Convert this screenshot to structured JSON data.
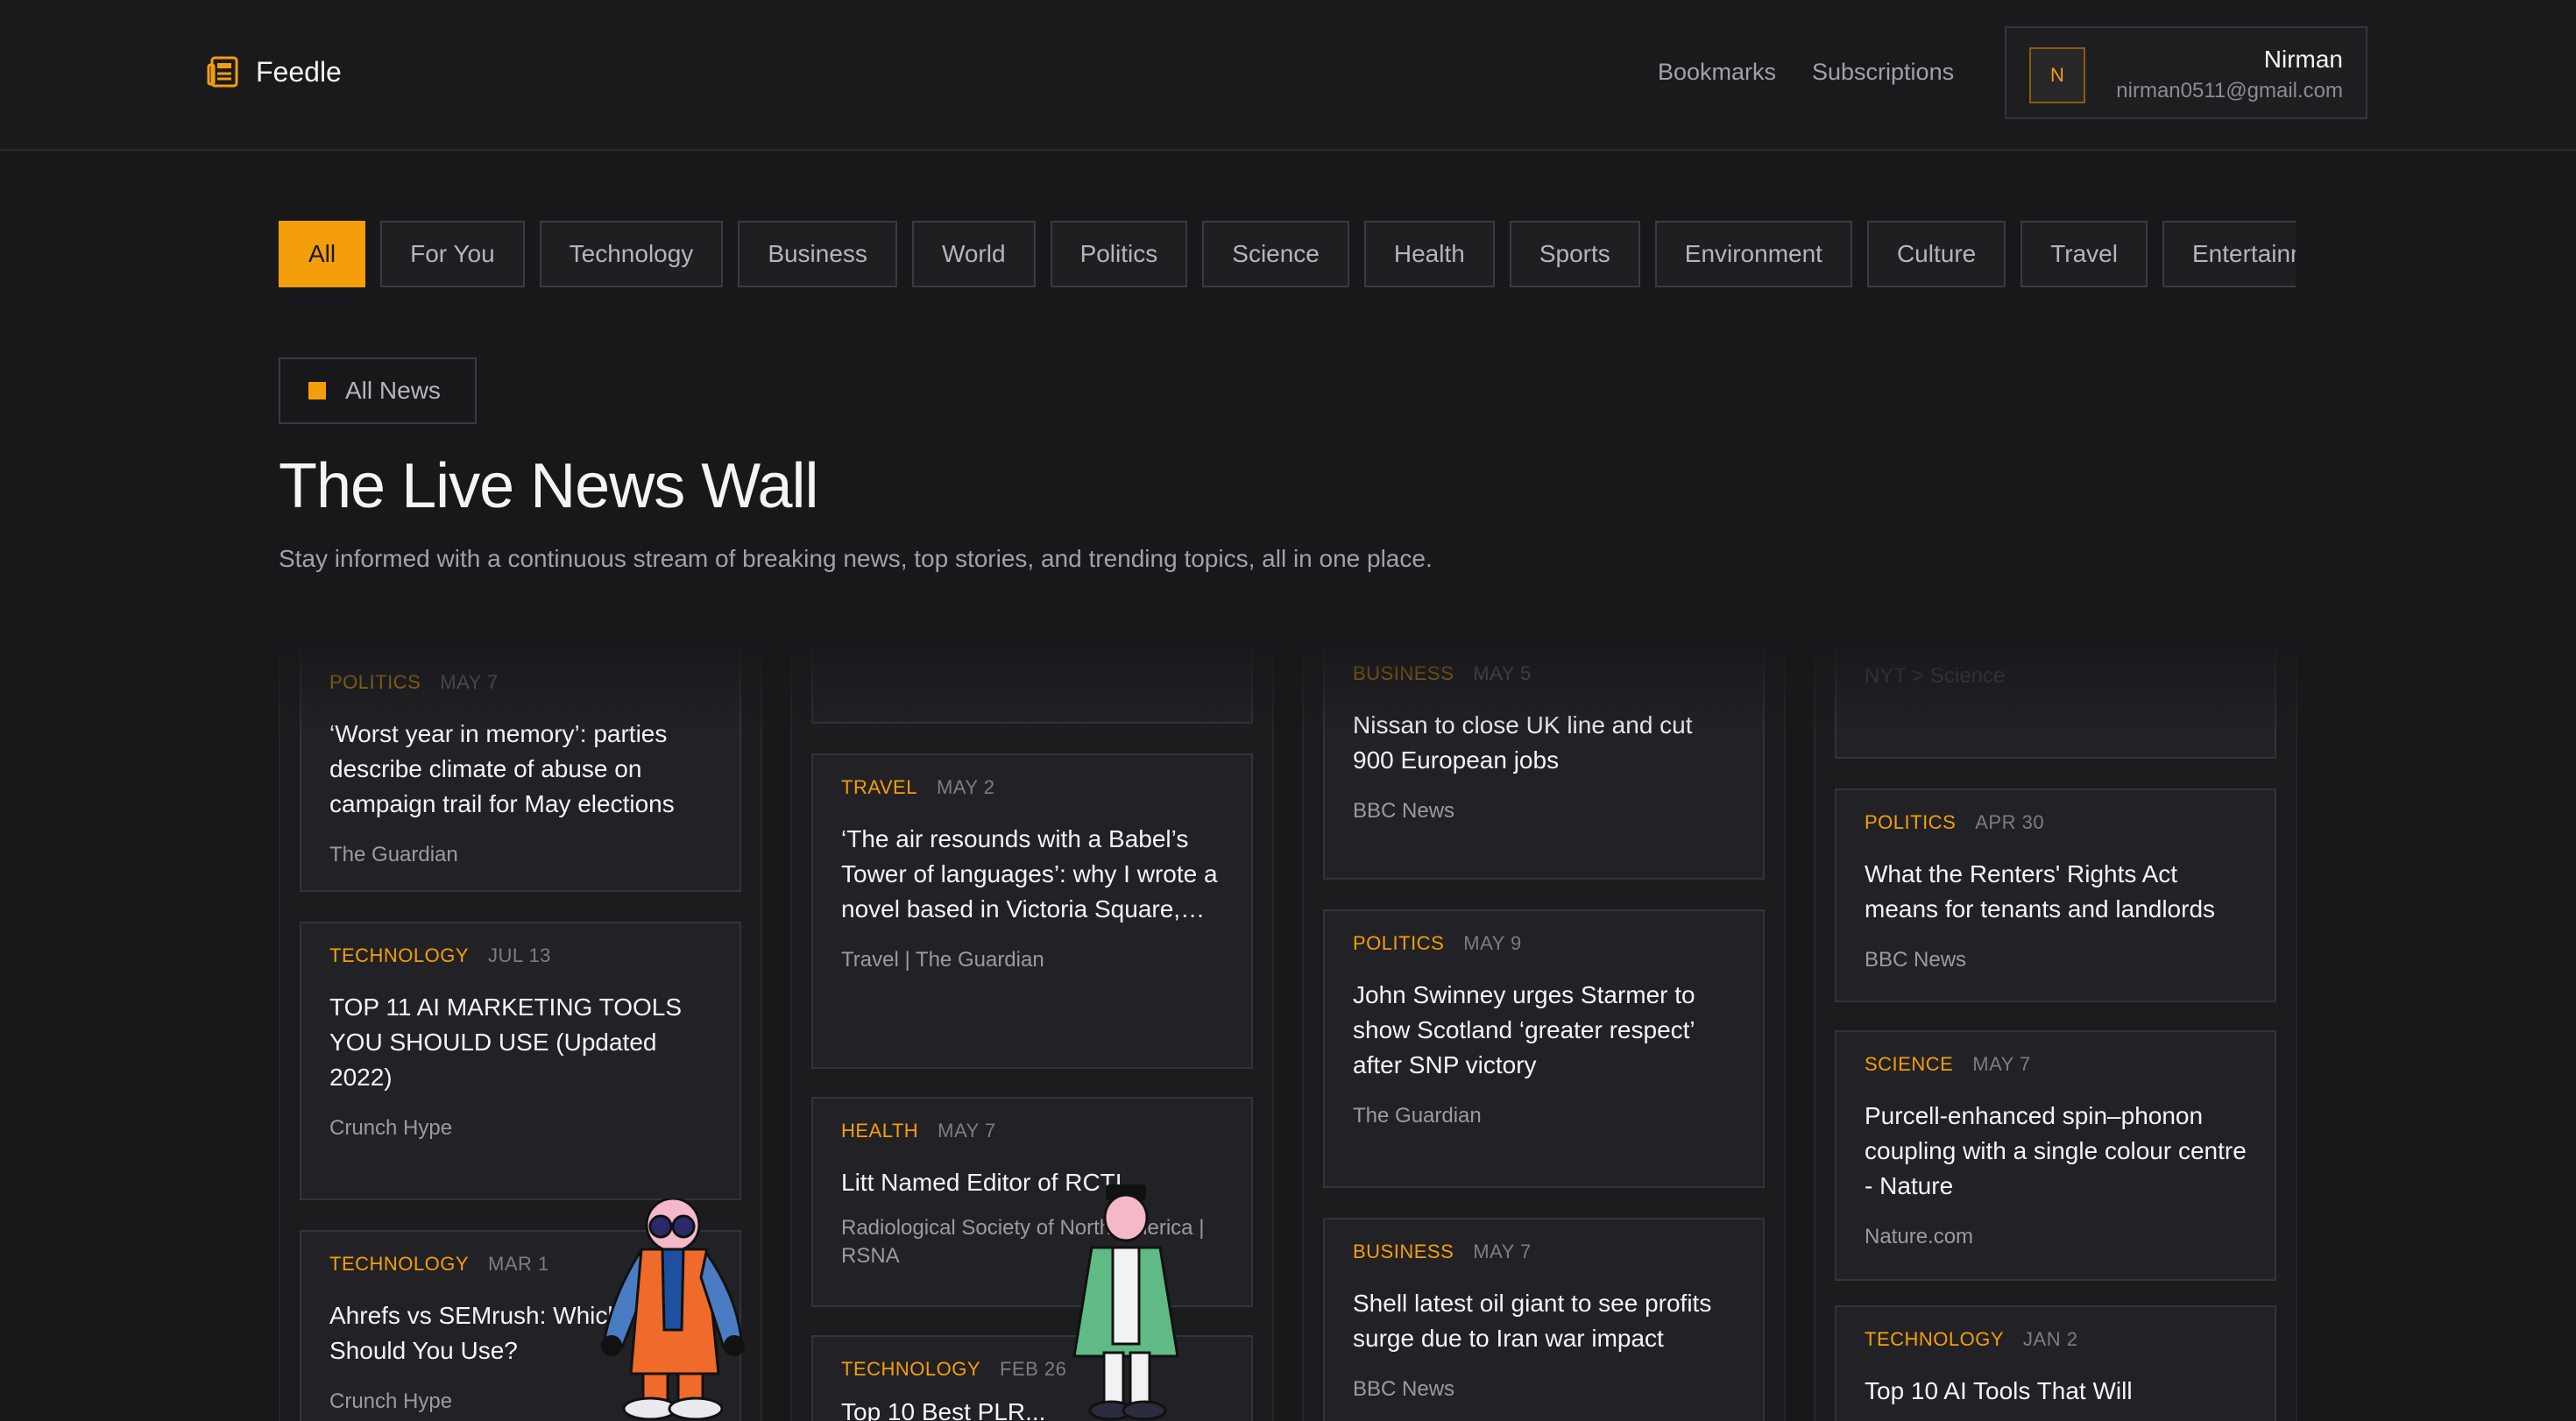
{
  "app": {
    "name": "Feedle"
  },
  "nav": {
    "bookmarks": "Bookmarks",
    "subscriptions": "Subscriptions"
  },
  "user": {
    "initial": "N",
    "name": "Nirman",
    "email": "nirman0511@gmail.com"
  },
  "categories": [
    "All",
    "For You",
    "Technology",
    "Business",
    "World",
    "Politics",
    "Science",
    "Health",
    "Sports",
    "Environment",
    "Culture",
    "Travel",
    "Entertainment"
  ],
  "filter": {
    "label": "All News"
  },
  "hero": {
    "title": "The Live News Wall",
    "subtitle": "Stay informed with a continuous stream of breaking news, top stories, and trending topics, all in one place."
  },
  "columns": [
    {
      "cards": [
        {
          "category": "POLITICS",
          "date": "MAY 7",
          "headline": "‘Worst year in memory’: parties describe climate of abuse on campaign trail for May elections",
          "source": "The Guardian"
        },
        {
          "category": "TECHNOLOGY",
          "date": "JUL 13",
          "headline": "TOP 11 AI MARKETING TOOLS YOU SHOULD USE (Updated 2022)",
          "source": "Crunch Hype"
        },
        {
          "category": "TECHNOLOGY",
          "date": "MAR 1",
          "headline": "Ahrefs vs SEMrush: Which Tool Should You Use?",
          "source": "Crunch Hype"
        }
      ]
    },
    {
      "cards": [
        {
          "category": "",
          "date": "",
          "headline": "",
          "source": ""
        },
        {
          "category": "TRAVEL",
          "date": "MAY 2",
          "headline": "‘The air resounds with a Babel’s Tower of languages’: why I wrote a novel based in Victoria Square,…",
          "source": "Travel | The Guardian"
        },
        {
          "category": "HEALTH",
          "date": "MAY 7",
          "headline": "Litt Named Editor of RCTI",
          "source": "Radiological Society of North America | RSNA"
        },
        {
          "category": "TECHNOLOGY",
          "date": "FEB 26",
          "headline": "Top 10 Best PLR...",
          "source": ""
        }
      ]
    },
    {
      "cards": [
        {
          "category": "BUSINESS",
          "date": "MAY 5",
          "headline": "Nissan to close UK line and cut 900 European jobs",
          "source": "BBC News"
        },
        {
          "category": "POLITICS",
          "date": "MAY 9",
          "headline": "John Swinney urges Starmer to show Scotland ‘greater respect’ after SNP victory",
          "source": "The Guardian"
        },
        {
          "category": "BUSINESS",
          "date": "MAY 7",
          "headline": "Shell latest oil giant to see profits surge due to Iran war impact",
          "source": "BBC News"
        }
      ]
    },
    {
      "cards": [
        {
          "category": "",
          "date": "",
          "headline": "",
          "source": "NYT > Science"
        },
        {
          "category": "POLITICS",
          "date": "APR 30",
          "headline": "What the Renters' Rights Act means for tenants and landlords",
          "source": "BBC News"
        },
        {
          "category": "SCIENCE",
          "date": "MAY 7",
          "headline": "Purcell-enhanced spin–phonon coupling with a single colour centre - Nature",
          "source": "Nature.com"
        },
        {
          "category": "TECHNOLOGY",
          "date": "JAN 2",
          "headline": "Top 10 AI Tools That Will",
          "source": ""
        }
      ]
    }
  ],
  "colors": {
    "accent": "#f59e0b",
    "background": "#18181b"
  }
}
